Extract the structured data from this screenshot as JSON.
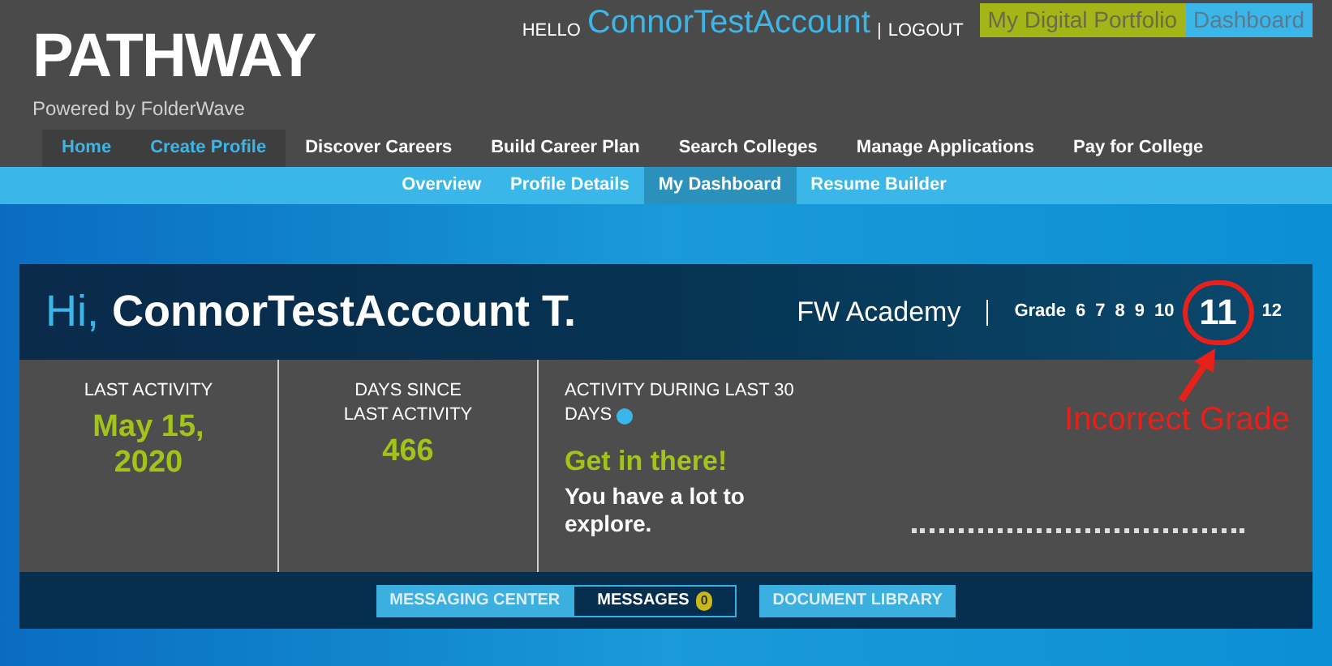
{
  "header": {
    "logo": "PATHWAY",
    "tagline": "Powered by FolderWave",
    "greeting": "HELLO",
    "username": "ConnorTestAccount",
    "separator": "|",
    "logout": "LOGOUT",
    "portfolio_button": "My Digital Portfolio",
    "dashboard_button": "Dashboard"
  },
  "nav": [
    {
      "label": "Home",
      "selected": true
    },
    {
      "label": "Create Profile",
      "selected": true
    },
    {
      "label": "Discover Careers",
      "selected": false
    },
    {
      "label": "Build Career Plan",
      "selected": false
    },
    {
      "label": "Search Colleges",
      "selected": false
    },
    {
      "label": "Manage Applications",
      "selected": false
    },
    {
      "label": "Pay for College",
      "selected": false
    }
  ],
  "subnav": [
    {
      "label": "Overview",
      "selected": false
    },
    {
      "label": "Profile Details",
      "selected": false
    },
    {
      "label": "My Dashboard",
      "selected": true
    },
    {
      "label": "Resume Builder",
      "selected": false
    }
  ],
  "panel": {
    "hi": "Hi,",
    "name": "ConnorTestAccount T.",
    "school": "FW Academy",
    "grade_label": "Grade",
    "grades": [
      {
        "label": "6",
        "selected": false
      },
      {
        "label": "7",
        "selected": false
      },
      {
        "label": "8",
        "selected": false
      },
      {
        "label": "9",
        "selected": false
      },
      {
        "label": "10",
        "selected": false
      },
      {
        "label": "11",
        "selected": true
      },
      {
        "label": "12",
        "selected": false
      }
    ],
    "stats": [
      {
        "label": "LAST ACTIVITY",
        "value": "May 15, 2020"
      },
      {
        "label": "DAYS SINCE LAST ACTIVITY",
        "value": "466"
      }
    ],
    "activity": {
      "label_lines": [
        "ACTIVITY DURING LAST 30",
        "DAYS"
      ],
      "headline": "Get in there!",
      "message": "You have a lot to explore."
    },
    "annotation": "Incorrect Grade",
    "footer": {
      "messaging_center": "MESSAGING CENTER",
      "messages": "MESSAGES",
      "message_count": "0",
      "document_library": "DOCUMENT LIBRARY"
    }
  }
}
